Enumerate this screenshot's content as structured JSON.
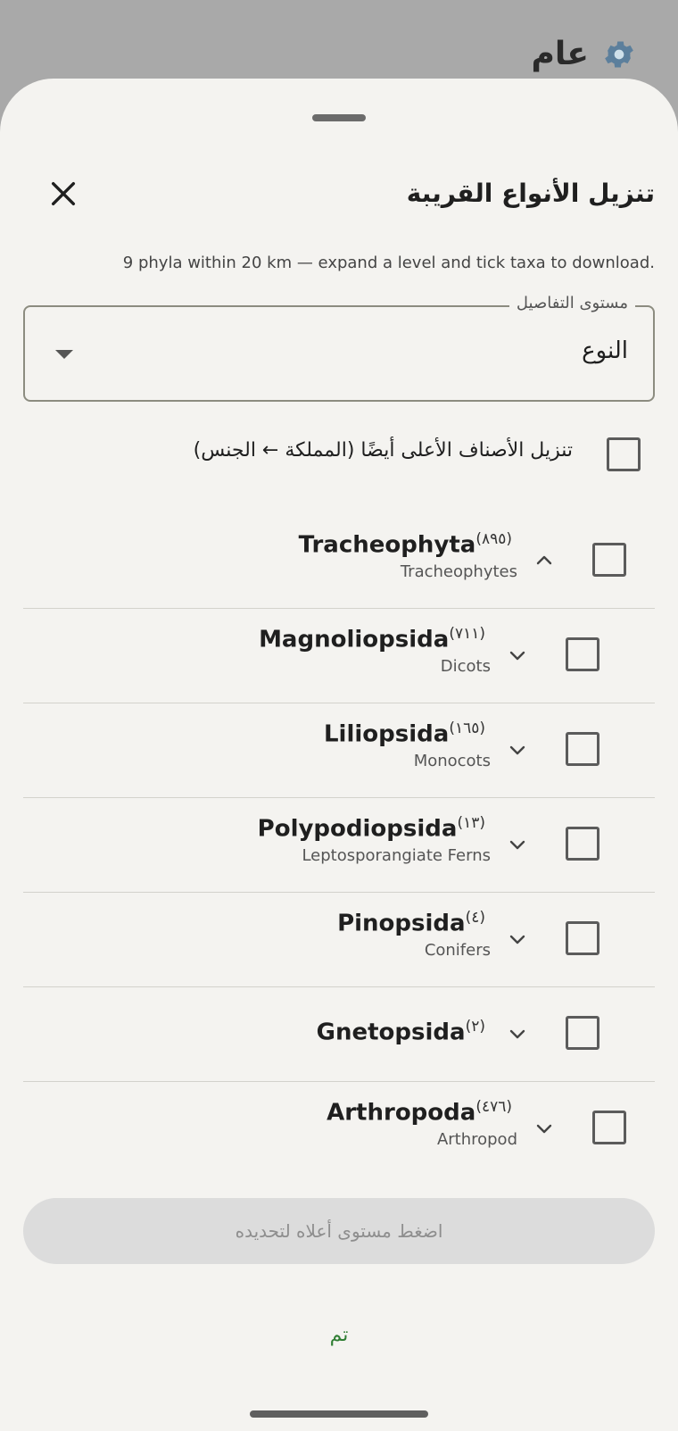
{
  "background": {
    "title": "عام",
    "icon": "gear-icon"
  },
  "sheet": {
    "title": "تنزيل الأنواع القريبة",
    "subtitle": "9 phyla within 20 km — expand a level and tick taxa to download.",
    "close_icon": "close-icon"
  },
  "detail_level": {
    "label": "مستوى التفاصيل",
    "value": "النوع"
  },
  "higher_ranks": {
    "label": "تنزيل الأصناف الأعلى أيضًا (المملكة ← الجنس)",
    "checked": false
  },
  "taxa": [
    {
      "name": "Tracheophyta",
      "count": "(٨٩٥)",
      "common": "Tracheophytes",
      "level": 0,
      "expanded": true,
      "checked": false
    },
    {
      "name": "Magnoliopsida",
      "count": "(٧١١)",
      "common": "Dicots",
      "level": 1,
      "expanded": false,
      "checked": false
    },
    {
      "name": "Liliopsida",
      "count": "(١٦٥)",
      "common": "Monocots",
      "level": 1,
      "expanded": false,
      "checked": false
    },
    {
      "name": "Polypodiopsida",
      "count": "(١٣)",
      "common": "Leptosporangiate Ferns",
      "level": 1,
      "expanded": false,
      "checked": false
    },
    {
      "name": "Pinopsida",
      "count": "(٤)",
      "common": "Conifers",
      "level": 1,
      "expanded": false,
      "checked": false
    },
    {
      "name": "Gnetopsida",
      "count": "(٢)",
      "common": "",
      "level": 1,
      "expanded": false,
      "checked": false
    },
    {
      "name": "Arthropoda",
      "count": "(٤٧٦)",
      "common": "Arthropod",
      "level": 0,
      "expanded": false,
      "checked": false
    }
  ],
  "action_button": {
    "label": "اضغط مستوى أعلاه لتحديده",
    "enabled": false
  },
  "done_button": {
    "label": "تم"
  },
  "colors": {
    "sheet_bg": "#f4f3f0",
    "scrim": "#a9a9a9",
    "accent_green": "#2e7d32",
    "disabled_button": "#dcdcdc"
  }
}
